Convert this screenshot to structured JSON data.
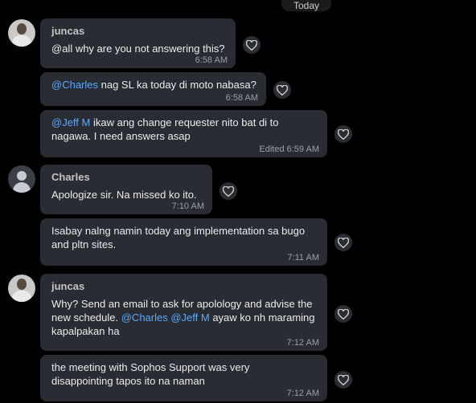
{
  "date_divider": "Today",
  "messages": [
    {
      "sender": "juncas",
      "text": "@all why are you not answering this?",
      "time": "6:58 AM"
    },
    {
      "mention": "@Charles",
      "text": " nag SL ka today di moto nabasa?",
      "time": "6:58 AM"
    },
    {
      "mention": "@Jeff M",
      "text_line1": " ikaw ang change requester nito bat di to",
      "text_line2": "nagawa. I need answers asap",
      "time": "Edited 6:59 AM"
    },
    {
      "sender": "Charles",
      "text": "Apologize sir. Na missed ko ito.",
      "time": "7:10 AM"
    },
    {
      "text_line1": "Isabay nalng namin today ang implementation sa bugo",
      "text_line2": "and pltn sites.",
      "time": "7:11 AM"
    },
    {
      "sender": "juncas",
      "text_line1": "Why? Send an email to ask for apolology and advise the",
      "text_line2a": "new schedule. ",
      "mention1": "@Charles",
      "mention2": "@Jeff M",
      "text_line2b": "  ayaw ko nh maraming",
      "text_line3": "kapalpakan ha",
      "time": "7:12 AM"
    },
    {
      "text_line1": "the meeting with Sophos Support was very",
      "text_line2": "disappointing tapos ito na naman",
      "time": "7:12 AM"
    }
  ],
  "icons": {
    "reaction": "heart-outline-icon"
  }
}
